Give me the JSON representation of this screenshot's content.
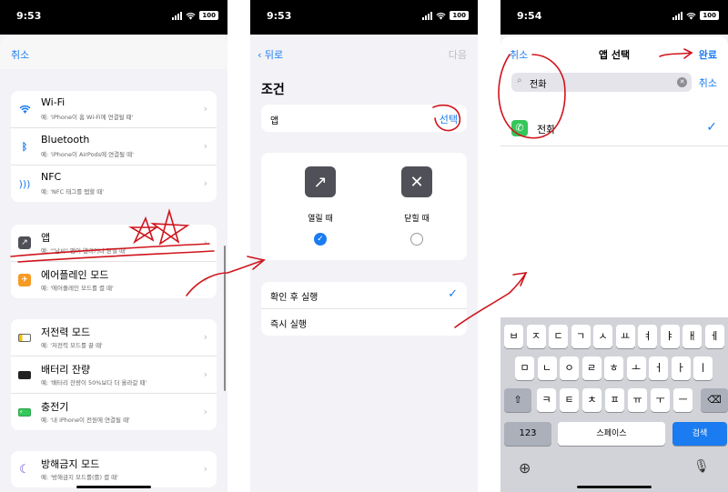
{
  "status_bar": {
    "p1_time": "9:53",
    "p2_time": "9:53",
    "p3_time": "9:54",
    "battery": "100"
  },
  "panel1": {
    "cancel": "취소",
    "rows_g1": [
      {
        "title": "Wi-Fi",
        "sub": "예: 'iPhone이 홈 Wi-Fi에 연결될 때'",
        "icon": "wifi-icon"
      },
      {
        "title": "Bluetooth",
        "sub": "예: 'iPhone이 AirPods에 연결될 때'",
        "icon": "bluetooth-icon"
      },
      {
        "title": "NFC",
        "sub": "예: 'NFC 태그를 탭할 때'",
        "icon": "nfc-icon"
      }
    ],
    "rows_g2": [
      {
        "title": "앱",
        "sub": "예: '\"날씨\" 앱이 열리거나 닫힐 때'",
        "icon": "app-icon"
      },
      {
        "title": "에어플레인 모드",
        "sub": "예: '에어플레인 모드를 켤 때'",
        "icon": "airplane-icon"
      }
    ],
    "rows_g3": [
      {
        "title": "저전력 모드",
        "sub": "예: '저전력 모드를 끌 때'",
        "icon": "low-power-icon"
      },
      {
        "title": "배터리 잔량",
        "sub": "예: '배터리 잔량이 50%보다 더 올라갈 때'",
        "icon": "battery-icon"
      },
      {
        "title": "충전기",
        "sub": "예: '내 iPhone이 전원에 연결될 때'",
        "icon": "charger-icon"
      }
    ],
    "rows_g4": [
      {
        "title": "방해금지 모드",
        "sub": "예: '방해금지 모드를(를) 켤 때'",
        "icon": "moon-icon"
      }
    ]
  },
  "panel2": {
    "back": "뒤로",
    "next": "다음",
    "section": "조건",
    "app_label": "앱",
    "app_select": "선택",
    "open_label": "열릴 때",
    "close_label": "닫힐 때",
    "confirm_run": "확인 후 실행",
    "run_now": "즉시 실행"
  },
  "panel3": {
    "cancel_top": "취소",
    "title": "앱 선택",
    "done": "완료",
    "search_value": "전화",
    "search_cancel": "취소",
    "result": "전화",
    "keys_row1": [
      "ㅂ",
      "ㅈ",
      "ㄷ",
      "ㄱ",
      "ㅅ",
      "ㅛ",
      "ㅕ",
      "ㅑ",
      "ㅐ",
      "ㅔ"
    ],
    "keys_row2": [
      "ㅁ",
      "ㄴ",
      "ㅇ",
      "ㄹ",
      "ㅎ",
      "ㅗ",
      "ㅓ",
      "ㅏ",
      "ㅣ"
    ],
    "keys_row3": [
      "ㅋ",
      "ㅌ",
      "ㅊ",
      "ㅍ",
      "ㅠ",
      "ㅜ",
      "ㅡ"
    ],
    "key_123": "123",
    "key_space": "스페이스",
    "key_search": "검색"
  },
  "colors": {
    "accent": "#1a7cf0",
    "annotation": "#d0141c"
  }
}
